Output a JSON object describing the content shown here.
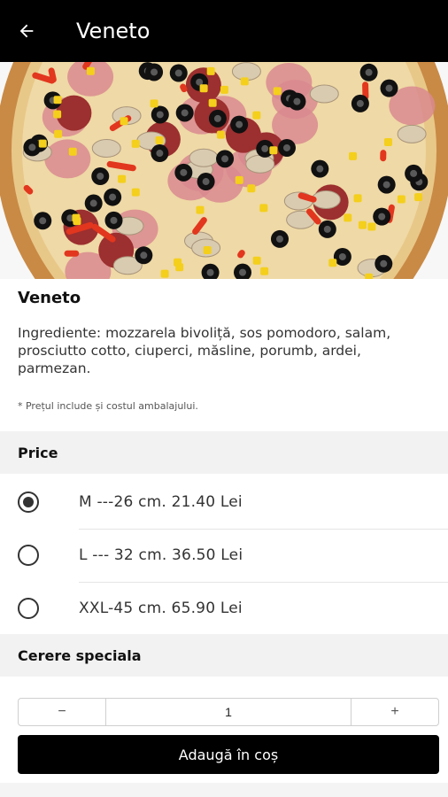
{
  "appbar": {
    "title": "Veneto"
  },
  "product": {
    "name": "Veneto",
    "description": "Ingrediente: mozzarela bivoliță, sos pomodoro, salam, prosciutto cotto, ciuperci, măsline, porumb, ardei, parmezan.",
    "note": "* Prețul include și costul ambalajului."
  },
  "price_section": {
    "title": "Price",
    "options": [
      {
        "label": "M ---26 cm.  21.40 Lei",
        "selected": true
      },
      {
        "label": "L --- 32 cm.  36.50 Lei",
        "selected": false
      },
      {
        "label": "XXL-45 cm.  65.90 Lei",
        "selected": false
      }
    ]
  },
  "special_section": {
    "title": "Cerere speciala"
  },
  "quantity": {
    "minus": "−",
    "value": "1",
    "plus": "+"
  },
  "add_button": {
    "label": "Adaugă în coș"
  },
  "colors": {
    "appbar": "#000000",
    "accent": "#000000",
    "section_bg": "#f2f2f2"
  }
}
